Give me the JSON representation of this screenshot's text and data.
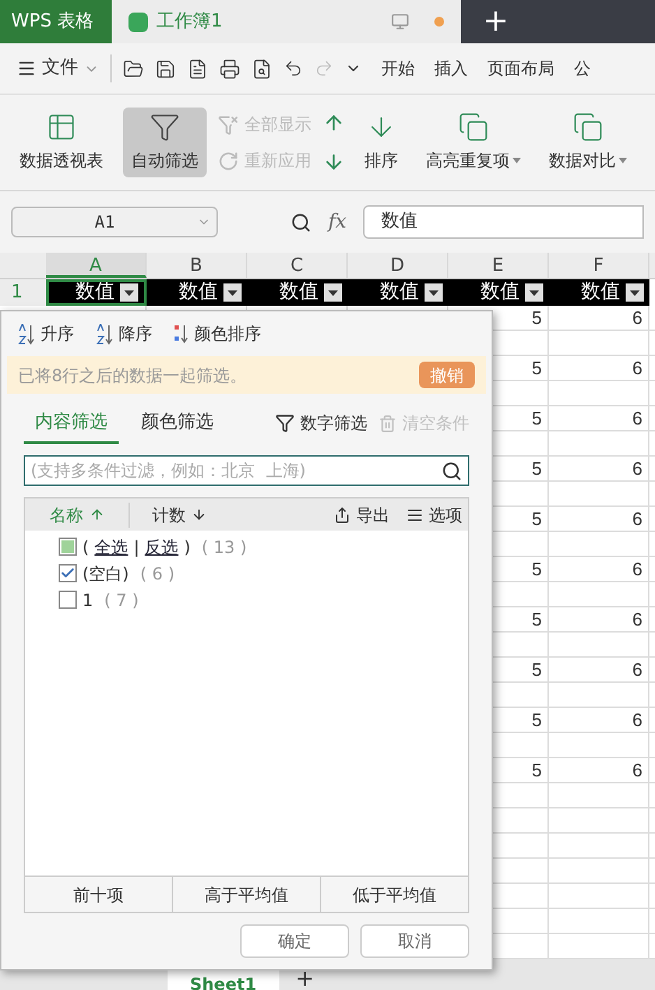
{
  "title_bar": {
    "app_tab": "WPS 表格",
    "doc_tab": {
      "title": "工作簿1",
      "unsaved": true
    },
    "new_tab": "+"
  },
  "menu_bar": {
    "file": "文件",
    "tabs": [
      "开始",
      "插入",
      "页面布局",
      "公"
    ]
  },
  "ribbon": {
    "items": [
      {
        "kind": "large",
        "label": "数据透视表",
        "selected": false
      },
      {
        "kind": "large",
        "label": "自动筛选",
        "selected": true
      },
      {
        "kind": "stack",
        "items": [
          {
            "label": "全部显示",
            "disabled": true
          },
          {
            "label": "重新应用",
            "disabled": true
          }
        ]
      },
      {
        "kind": "sort_icons"
      },
      {
        "kind": "large",
        "label": "排序",
        "selected": false
      },
      {
        "kind": "large",
        "label": "高亮重复项",
        "dropdown": true,
        "selected": false
      },
      {
        "kind": "large",
        "label": "数据对比",
        "dropdown": true,
        "selected": false
      }
    ]
  },
  "formula_bar": {
    "name_box": "A1",
    "fx": "fx",
    "value": "数值"
  },
  "sheet": {
    "columns": [
      {
        "label": "A",
        "selected": true
      },
      {
        "label": "B",
        "selected": false
      },
      {
        "label": "C",
        "selected": false
      },
      {
        "label": "D",
        "selected": false
      },
      {
        "label": "E",
        "selected": false
      },
      {
        "label": "F",
        "selected": false
      }
    ],
    "header_row": {
      "number": "1",
      "cells": [
        "数值",
        "数值",
        "数值",
        "数值",
        "数值",
        "数值"
      ]
    },
    "data_rows": [
      {
        "column_e": "5",
        "column_f": "6"
      },
      {
        "column_e": "5",
        "column_f": "6"
      },
      {
        "column_e": "5",
        "column_f": "6"
      },
      {
        "column_e": "5",
        "column_f": "6"
      },
      {
        "column_e": "5",
        "column_f": "6"
      },
      {
        "column_e": "5",
        "column_f": "6"
      },
      {
        "column_e": "5",
        "column_f": "6"
      },
      {
        "column_e": "5",
        "column_f": "6"
      },
      {
        "column_e": "5",
        "column_f": "6"
      },
      {
        "column_e": "5",
        "column_f": "6"
      }
    ]
  },
  "filter_popup": {
    "sort": [
      "升序",
      "降序",
      "颜色排序"
    ],
    "notice": "已将8行之后的数据一起筛选。",
    "undo": "撤销",
    "tabs": [
      {
        "label": "内容筛选",
        "selected": true
      },
      {
        "label": "颜色筛选",
        "selected": false
      }
    ],
    "number_filter": "数字筛选",
    "clear": {
      "label": "清空条件",
      "disabled": true
    },
    "search": {
      "placeholder": "(支持多条件过滤，例如：北京  上海)"
    },
    "list_header": {
      "name": "名称",
      "count": "计数",
      "export": "导出",
      "options": "选项"
    },
    "select_all": {
      "prefix": "(",
      "select": "全选",
      "separator": "|",
      "invert": "反选",
      "suffix": ")",
      "count": "( 13 )",
      "partial": true
    },
    "items": [
      {
        "label": "(空白)",
        "count": "( 6 )",
        "checked": true
      },
      {
        "label": "1",
        "count": "( 7 )",
        "checked": false
      }
    ],
    "quick_buttons": [
      "前十项",
      "高于平均值",
      "低于平均值"
    ],
    "ok": "确定",
    "cancel": "取消"
  },
  "sheet_tabs": {
    "tabs": [
      {
        "label": "Sheet1",
        "selected": true
      }
    ],
    "add": "+"
  }
}
